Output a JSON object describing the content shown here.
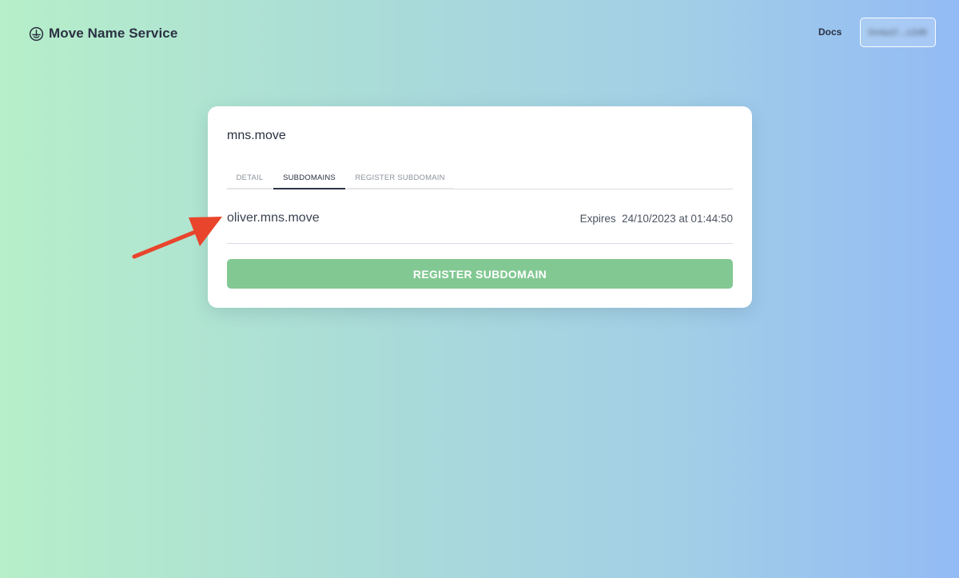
{
  "header": {
    "brand_name": "Move Name Service",
    "brand_icon": "anchor-circle-icon",
    "docs_label": "Docs",
    "wallet_address": "0x4a1f…c2d9"
  },
  "card": {
    "domain": "mns.move",
    "tabs": [
      {
        "label": "DETAIL",
        "active": false
      },
      {
        "label": "SUBDOMAINS",
        "active": true
      },
      {
        "label": "REGISTER SUBDOMAIN",
        "active": false
      }
    ],
    "subdomains": [
      {
        "name": "oliver.mns.move",
        "expiry": "Expires  24/10/2023 at 01:44:50"
      }
    ],
    "register_button_label": "REGISTER SUBDOMAIN"
  },
  "colors": {
    "accent_green": "#82c892",
    "annotation_arrow": "#e8452c",
    "text_dark": "#2b3142"
  }
}
